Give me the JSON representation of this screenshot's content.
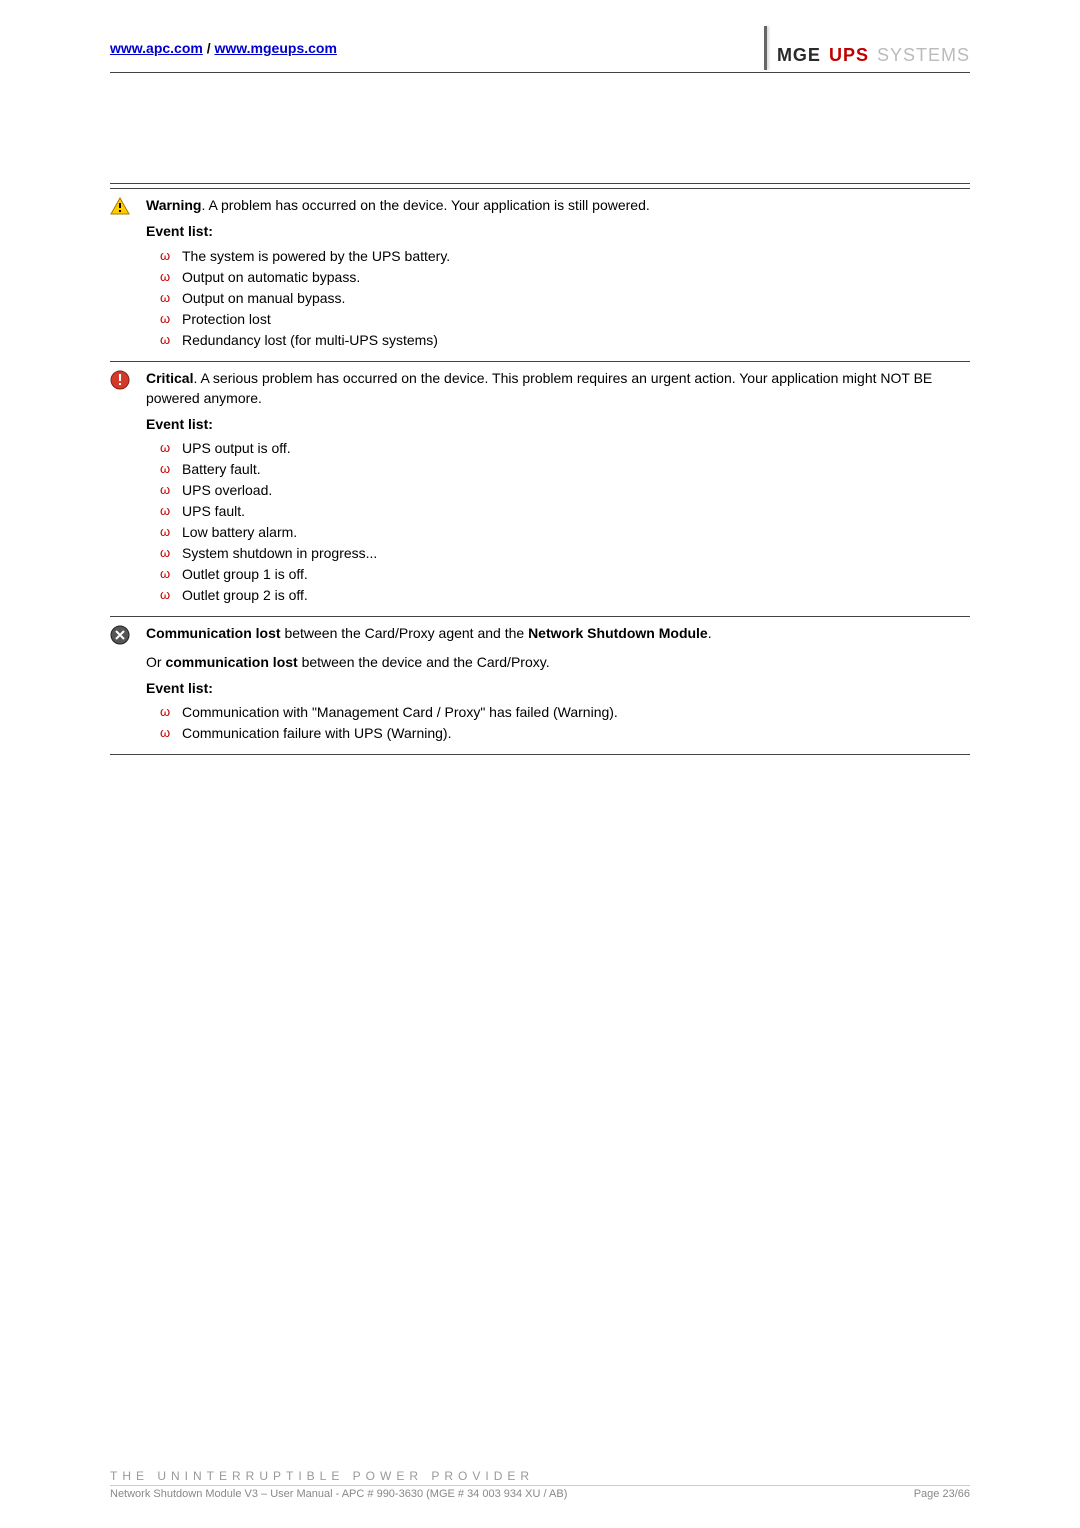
{
  "header": {
    "link1": "www.apc.com",
    "sep": " / ",
    "link2": "www.mgeups.com",
    "brand_mge": "MGE",
    "brand_ups": "UPS",
    "brand_systems": "SYSTEMS"
  },
  "warning_section": {
    "title": "Warning",
    "text": ". A problem has occurred on the device. Your application is still powered.",
    "heading": "Event list:",
    "items": [
      "The system is powered by the UPS battery.",
      "Output on automatic bypass.",
      "Output on manual bypass.",
      "Protection lost",
      "Redundancy lost (for multi-UPS systems)"
    ]
  },
  "critical_section": {
    "title": "Critical",
    "text": ". A serious problem has occurred on the device. This problem requires an urgent action. Your application might NOT BE powered anymore.",
    "heading": "Event list:",
    "items": [
      "UPS output is off.",
      "Battery fault.",
      "UPS overload.",
      "UPS fault.",
      "Low battery alarm.",
      "System shutdown in progress...",
      "Outlet group 1 is off.",
      "Outlet group 2 is off."
    ]
  },
  "comm_section": {
    "line1_pre": "Communication lost",
    "line1_mid": " between the Card/Proxy agent and the ",
    "line1_bold2": "Network Shutdown Module",
    "line1_post": ".",
    "line2_pre": "Or ",
    "line2_bold": "communication lost",
    "line2_post": " between the device and the Card/Proxy.",
    "heading": "Event list:",
    "items": [
      "Communication with \"Management Card / Proxy\" has failed (Warning).",
      "Communication failure with UPS (Warning)."
    ]
  },
  "footer": {
    "tagline": "THE UNINTERRUPTIBLE POWER PROVIDER",
    "docinfo": "Network Shutdown Module V3 – User Manual - APC # 990-3630 (MGE # 34 003 934 XU / AB)",
    "page": "Page 23/66"
  }
}
